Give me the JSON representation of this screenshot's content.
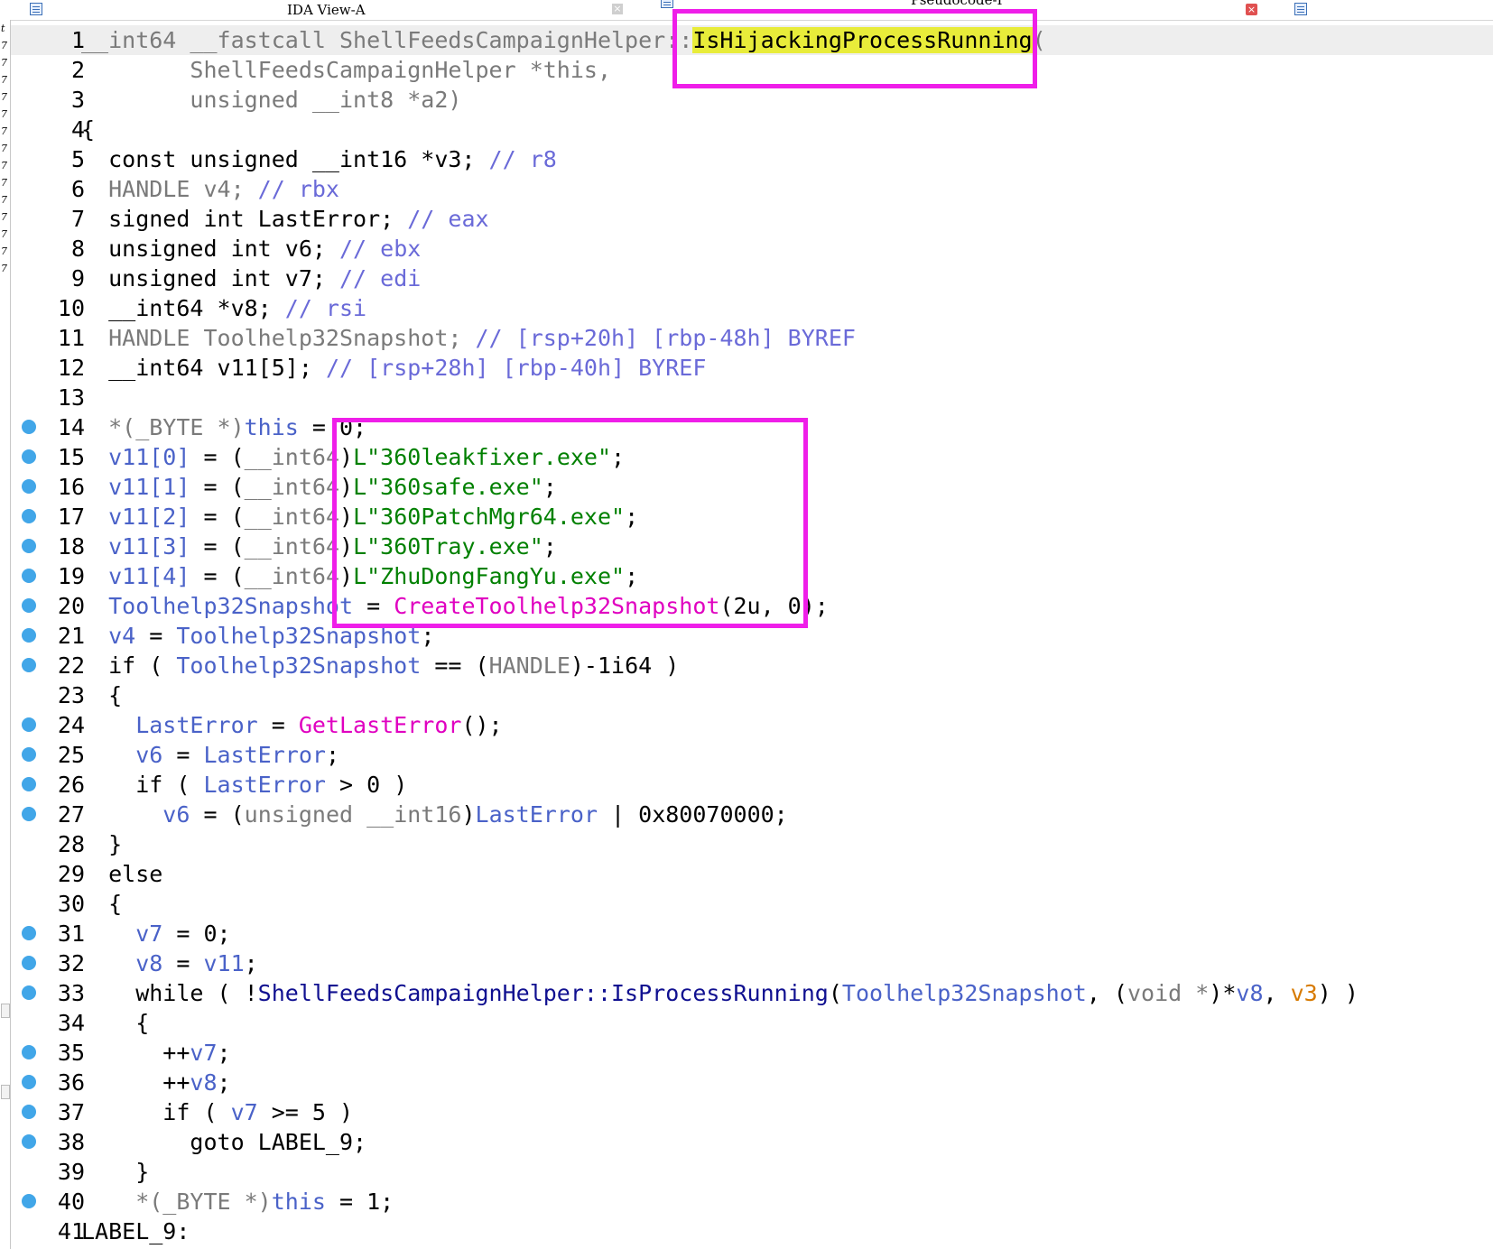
{
  "tabs": [
    {
      "label": "IDA View-A",
      "icon": "document-icon",
      "close": "×"
    },
    {
      "label": "Pseudocode-I",
      "icon": "document-icon",
      "close": "×"
    },
    {
      "label": "",
      "icon": "document-icon"
    }
  ],
  "left_strip_chars": [
    "t",
    "7",
    "7",
    "7",
    "7",
    "7",
    "7",
    "7",
    "7",
    "7",
    "7",
    "7",
    "7",
    "7",
    "7"
  ],
  "code_lines": [
    {
      "n": "1",
      "bp": false,
      "current": true,
      "tokens": [
        [
          "__int64 __fastcall ShellFeedsCampaignHelper::",
          "g"
        ],
        [
          "IsHijackingProcessRunning",
          "hl"
        ],
        [
          "(",
          "g"
        ]
      ]
    },
    {
      "n": "2",
      "bp": false,
      "tokens": [
        [
          "        ShellFeedsCampaignHelper *this,",
          "g"
        ]
      ]
    },
    {
      "n": "3",
      "bp": false,
      "tokens": [
        [
          "        unsigned __int8 *a2)",
          "g"
        ]
      ]
    },
    {
      "n": "4",
      "bp": false,
      "tokens": [
        [
          "{",
          "kw"
        ]
      ]
    },
    {
      "n": "5",
      "bp": false,
      "tokens": [
        [
          "  const unsigned __int16 *v3; ",
          "kw"
        ],
        [
          "// r8",
          "cm"
        ]
      ]
    },
    {
      "n": "6",
      "bp": false,
      "tokens": [
        [
          "  HANDLE v4; ",
          "g"
        ],
        [
          "// rbx",
          "cm"
        ]
      ]
    },
    {
      "n": "7",
      "bp": false,
      "tokens": [
        [
          "  signed int LastError; ",
          "kw"
        ],
        [
          "// eax",
          "cm"
        ]
      ]
    },
    {
      "n": "8",
      "bp": false,
      "tokens": [
        [
          "  unsigned int v6; ",
          "kw"
        ],
        [
          "// ebx",
          "cm"
        ]
      ]
    },
    {
      "n": "9",
      "bp": false,
      "tokens": [
        [
          "  unsigned int v7; ",
          "kw"
        ],
        [
          "// edi",
          "cm"
        ]
      ]
    },
    {
      "n": "10",
      "bp": false,
      "tokens": [
        [
          "  __int64 *v8; ",
          "kw"
        ],
        [
          "// rsi",
          "cm"
        ]
      ]
    },
    {
      "n": "11",
      "bp": false,
      "tokens": [
        [
          "  HANDLE Toolhelp32Snapshot; ",
          "g"
        ],
        [
          "// [rsp+20h] [rbp-48h] BYREF",
          "cm"
        ]
      ]
    },
    {
      "n": "12",
      "bp": false,
      "tokens": [
        [
          "  __int64 v11[5]; ",
          "kw"
        ],
        [
          "// [rsp+28h] [rbp-40h] BYREF",
          "cm"
        ]
      ]
    },
    {
      "n": "13",
      "bp": false,
      "tokens": []
    },
    {
      "n": "14",
      "bp": true,
      "tokens": [
        [
          "  *(_BYTE *)",
          "g"
        ],
        [
          "this",
          "v"
        ],
        [
          " = 0;",
          "n"
        ]
      ]
    },
    {
      "n": "15",
      "bp": true,
      "tokens": [
        [
          "  v11[0]",
          "v"
        ],
        [
          " = (",
          "n"
        ],
        [
          "__int64",
          "g"
        ],
        [
          ")",
          "n"
        ],
        [
          "L\"360leakfixer.exe\"",
          "s"
        ],
        [
          ";",
          "n"
        ]
      ]
    },
    {
      "n": "16",
      "bp": true,
      "tokens": [
        [
          "  v11[1]",
          "v"
        ],
        [
          " = (",
          "n"
        ],
        [
          "__int64",
          "g"
        ],
        [
          ")",
          "n"
        ],
        [
          "L\"360safe.exe\"",
          "s"
        ],
        [
          ";",
          "n"
        ]
      ]
    },
    {
      "n": "17",
      "bp": true,
      "tokens": [
        [
          "  v11[2]",
          "v"
        ],
        [
          " = (",
          "n"
        ],
        [
          "__int64",
          "g"
        ],
        [
          ")",
          "n"
        ],
        [
          "L\"360PatchMgr64.exe\"",
          "s"
        ],
        [
          ";",
          "n"
        ]
      ]
    },
    {
      "n": "18",
      "bp": true,
      "tokens": [
        [
          "  v11[3]",
          "v"
        ],
        [
          " = (",
          "n"
        ],
        [
          "__int64",
          "g"
        ],
        [
          ")",
          "n"
        ],
        [
          "L\"360Tray.exe\"",
          "s"
        ],
        [
          ";",
          "n"
        ]
      ]
    },
    {
      "n": "19",
      "bp": true,
      "tokens": [
        [
          "  v11[4]",
          "v"
        ],
        [
          " = (",
          "n"
        ],
        [
          "__int64",
          "g"
        ],
        [
          ")",
          "n"
        ],
        [
          "L\"ZhuDongFangYu.exe\"",
          "s"
        ],
        [
          ";",
          "n"
        ]
      ]
    },
    {
      "n": "20",
      "bp": true,
      "tokens": [
        [
          "  Toolhelp32Snapshot",
          "v"
        ],
        [
          " = ",
          "n"
        ],
        [
          "CreateToolhelp32Snapshot",
          "fn"
        ],
        [
          "(2u, 0);",
          "n"
        ]
      ]
    },
    {
      "n": "21",
      "bp": true,
      "tokens": [
        [
          "  v4",
          "v"
        ],
        [
          " = ",
          "n"
        ],
        [
          "Toolhelp32Snapshot",
          "v"
        ],
        [
          ";",
          "n"
        ]
      ]
    },
    {
      "n": "22",
      "bp": true,
      "tokens": [
        [
          "  if ( ",
          "kw"
        ],
        [
          "Toolhelp32Snapshot",
          "v"
        ],
        [
          " == (",
          "n"
        ],
        [
          "HANDLE",
          "g"
        ],
        [
          ")-1i64 )",
          "n"
        ]
      ]
    },
    {
      "n": "23",
      "bp": false,
      "tokens": [
        [
          "  {",
          "kw"
        ]
      ]
    },
    {
      "n": "24",
      "bp": true,
      "tokens": [
        [
          "    LastError",
          "v"
        ],
        [
          " = ",
          "n"
        ],
        [
          "GetLastError",
          "fn"
        ],
        [
          "();",
          "n"
        ]
      ]
    },
    {
      "n": "25",
      "bp": true,
      "tokens": [
        [
          "    v6",
          "v"
        ],
        [
          " = ",
          "n"
        ],
        [
          "LastError",
          "v"
        ],
        [
          ";",
          "n"
        ]
      ]
    },
    {
      "n": "26",
      "bp": true,
      "tokens": [
        [
          "    if ( ",
          "kw"
        ],
        [
          "LastError",
          "v"
        ],
        [
          " > 0 )",
          "n"
        ]
      ]
    },
    {
      "n": "27",
      "bp": true,
      "tokens": [
        [
          "      v6",
          "v"
        ],
        [
          " = (",
          "n"
        ],
        [
          "unsigned __int16",
          "g"
        ],
        [
          ")",
          "n"
        ],
        [
          "LastError",
          "v"
        ],
        [
          " | 0x80070000;",
          "n"
        ]
      ]
    },
    {
      "n": "28",
      "bp": false,
      "tokens": [
        [
          "  }",
          "kw"
        ]
      ]
    },
    {
      "n": "29",
      "bp": false,
      "tokens": [
        [
          "  else",
          "kw"
        ]
      ]
    },
    {
      "n": "30",
      "bp": false,
      "tokens": [
        [
          "  {",
          "kw"
        ]
      ]
    },
    {
      "n": "31",
      "bp": true,
      "tokens": [
        [
          "    v7",
          "v"
        ],
        [
          " = 0;",
          "n"
        ]
      ]
    },
    {
      "n": "32",
      "bp": true,
      "tokens": [
        [
          "    v8",
          "v"
        ],
        [
          " = ",
          "n"
        ],
        [
          "v11",
          "v"
        ],
        [
          ";",
          "n"
        ]
      ]
    },
    {
      "n": "33",
      "bp": true,
      "tokens": [
        [
          "    while ( !",
          "kw"
        ],
        [
          "ShellFeedsCampaignHelper::IsProcessRunning",
          "call"
        ],
        [
          "(",
          "n"
        ],
        [
          "Toolhelp32Snapshot",
          "v"
        ],
        [
          ", (",
          "n"
        ],
        [
          "void *",
          "g"
        ],
        [
          ")*",
          "n"
        ],
        [
          "v8",
          "v"
        ],
        [
          ", ",
          "n"
        ],
        [
          "v3",
          "o"
        ],
        [
          ") )",
          "n"
        ]
      ]
    },
    {
      "n": "34",
      "bp": false,
      "tokens": [
        [
          "    {",
          "kw"
        ]
      ]
    },
    {
      "n": "35",
      "bp": true,
      "tokens": [
        [
          "      ++",
          "n"
        ],
        [
          "v7",
          "v"
        ],
        [
          ";",
          "n"
        ]
      ]
    },
    {
      "n": "36",
      "bp": true,
      "tokens": [
        [
          "      ++",
          "n"
        ],
        [
          "v8",
          "v"
        ],
        [
          ";",
          "n"
        ]
      ]
    },
    {
      "n": "37",
      "bp": true,
      "tokens": [
        [
          "      if ( ",
          "kw"
        ],
        [
          "v7",
          "v"
        ],
        [
          " >= 5 )",
          "n"
        ]
      ]
    },
    {
      "n": "38",
      "bp": true,
      "tokens": [
        [
          "        goto LABEL_9;",
          "kw"
        ]
      ]
    },
    {
      "n": "39",
      "bp": false,
      "tokens": [
        [
          "    }",
          "kw"
        ]
      ]
    },
    {
      "n": "40",
      "bp": true,
      "tokens": [
        [
          "    *(_BYTE *)",
          "g"
        ],
        [
          "this",
          "v"
        ],
        [
          " = 1;",
          "n"
        ]
      ]
    },
    {
      "n": "41",
      "bp": false,
      "tokens": [
        [
          "LABEL_9:",
          "kw"
        ]
      ]
    }
  ],
  "colors": {
    "highlight_box": "#ef1ee9",
    "breakpoint": "#41a6e8",
    "string": "#008000",
    "function": "#e000c0"
  }
}
